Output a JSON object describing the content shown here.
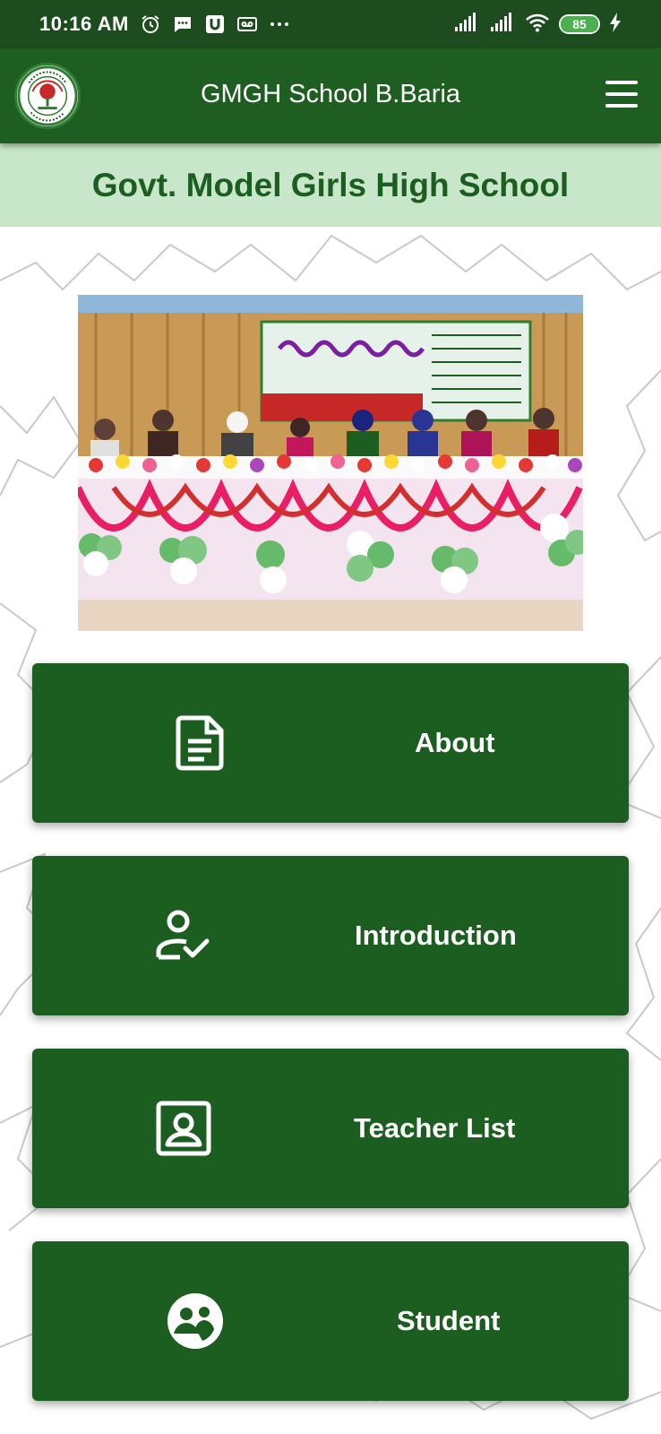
{
  "status_bar": {
    "time": "10:16 AM",
    "battery": "85"
  },
  "app_bar": {
    "title": "GMGH School B.Baria"
  },
  "banner": {
    "school_name": "Govt. Model Girls High School"
  },
  "menu": [
    {
      "label": "About",
      "icon": "document-icon"
    },
    {
      "label": "Introduction",
      "icon": "person-check-icon"
    },
    {
      "label": "Teacher List",
      "icon": "contact-card-icon"
    },
    {
      "label": "Student",
      "icon": "group-icon"
    }
  ],
  "colors": {
    "status_bar": "#1d4d1e",
    "app_bar": "#1e5e20",
    "banner_bg": "#c8e6c9",
    "banner_text": "#1b5e20",
    "card": "#1b5e20"
  }
}
